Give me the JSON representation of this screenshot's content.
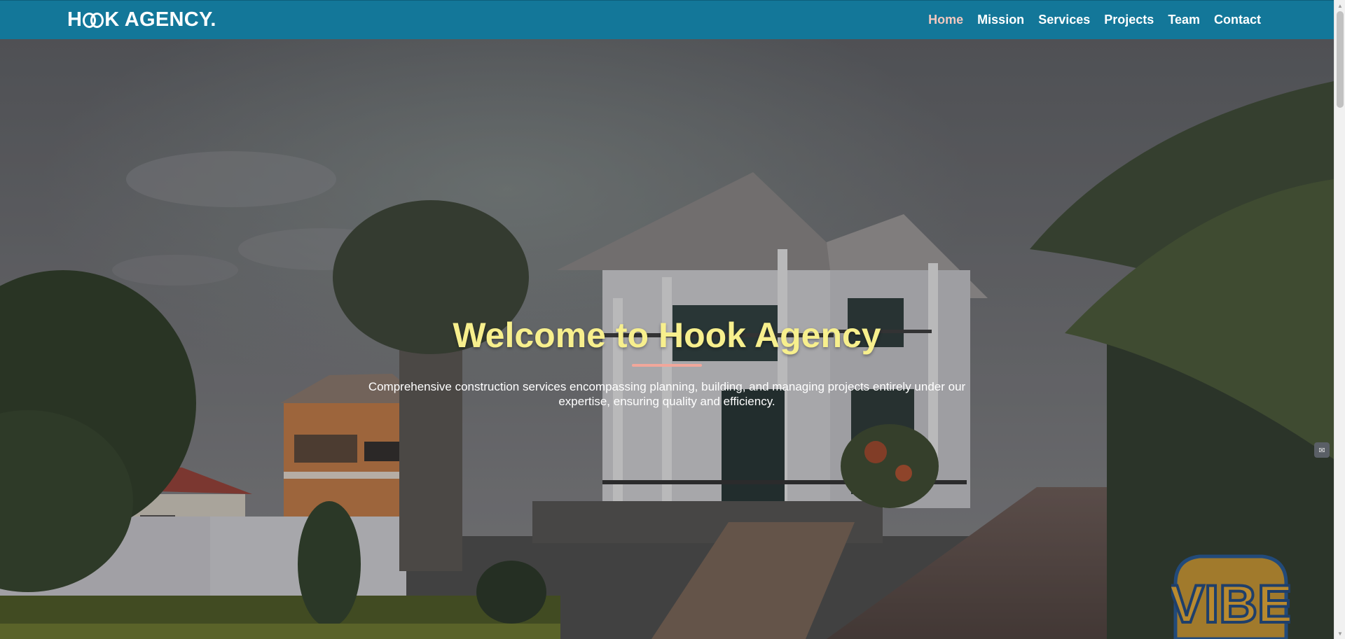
{
  "brand": {
    "name_prefix": "H",
    "name_suffix": "K AGENCY."
  },
  "nav": {
    "items": [
      {
        "label": "Home",
        "active": true
      },
      {
        "label": "Mission",
        "active": false
      },
      {
        "label": "Services",
        "active": false
      },
      {
        "label": "Projects",
        "active": false
      },
      {
        "label": "Team",
        "active": false
      },
      {
        "label": "Contact",
        "active": false
      }
    ]
  },
  "hero": {
    "title": "Welcome to Hook Agency",
    "subtitle": "Comprehensive construction services encompassing planning, building, and managing projects entirely under our expertise, ensuring quality and efficiency.",
    "background_icon": "villa-photo",
    "watermark": "VIBE"
  },
  "colors": {
    "navbar": "#137799",
    "nav_active": "#f2c8bf",
    "title": "#f7ef8d",
    "divider": "#f1a79b"
  },
  "icons": {
    "side_widget": "chat-icon",
    "scroll_up": "chevron-up-icon",
    "scroll_down": "chevron-down-icon"
  }
}
